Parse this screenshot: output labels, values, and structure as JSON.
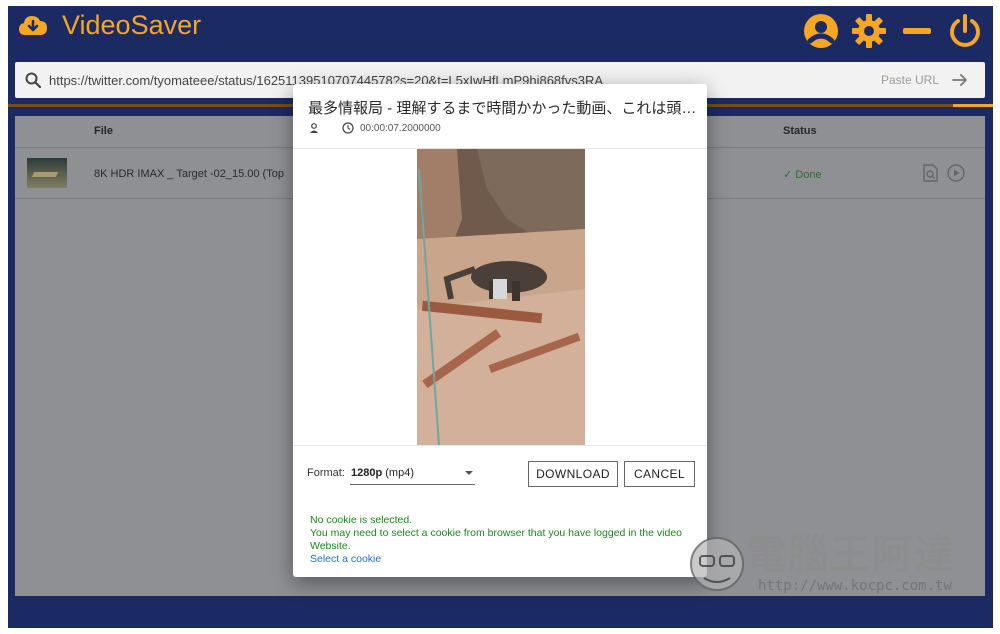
{
  "app": {
    "title": "VideoSaver"
  },
  "url_bar": {
    "value": "https://twitter.com/tyomateee/status/1625113951070744578?s=20&t=L5xIwHfLmP9hi868fvs3RA",
    "paste_label": "Paste URL"
  },
  "table": {
    "headers": {
      "file": "File",
      "status": "Status"
    },
    "rows": [
      {
        "file": "8K HDR IMAX _ Target -02_15.00 (Top",
        "status": "✓ Done"
      }
    ]
  },
  "dialog": {
    "title": "最多情報局 - 理解するまで時間かかった動画、これは頭がパ...",
    "duration": "00:00:07.2000000",
    "format_label": "Format:",
    "format_value_bold": "1280p",
    "format_value_rest": " (mp4)",
    "download_label": "DOWNLOAD",
    "cancel_label": "CANCEL",
    "cookie_line1": "No cookie is selected.",
    "cookie_line2": "You may need to select a cookie from browser that you have logged in the video",
    "cookie_line3": "Website.",
    "cookie_link": "Select a cookie"
  },
  "watermark": {
    "text": "電腦王阿達",
    "url": "http://www.kocpc.com.tw"
  },
  "colors": {
    "accent": "#f5a623",
    "header_bg": "#1b2a63",
    "done": "#2f6c2f",
    "cookie_warning": "#1a8a1a",
    "link": "#1f6fd6"
  }
}
